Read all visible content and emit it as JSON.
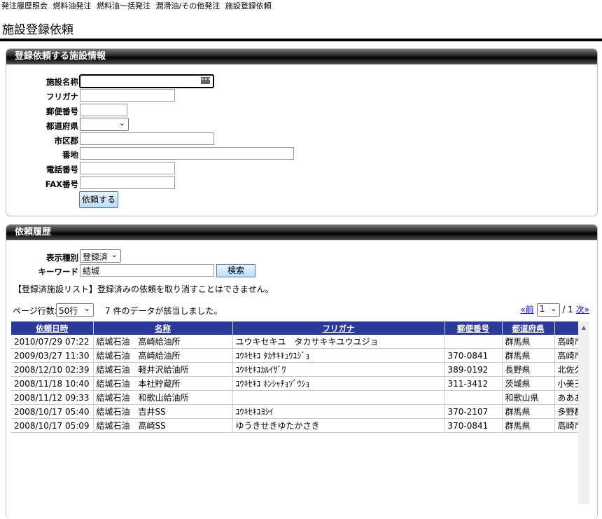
{
  "nav": {
    "items": [
      "発注履歴照会",
      "燃料油発注",
      "燃料油一括発注",
      "潤滑油/その他発注",
      "施設登録依頼"
    ]
  },
  "page_title": "施設登録依頼",
  "register_panel": {
    "title": "登録依頼する施設情報",
    "labels": {
      "name": "施設名称",
      "kana": "フリガナ",
      "zip": "郵便番号",
      "pref": "都道府県",
      "city": "市区郡",
      "address": "番地",
      "tel": "電話番号",
      "fax": "FAX番号"
    },
    "values": {
      "name": "",
      "kana": "",
      "zip": "",
      "pref": "",
      "city": "",
      "address": "",
      "tel": "",
      "fax": ""
    },
    "name_field_icon": "ellipsis-icon",
    "submit_label": "依頼する"
  },
  "history_panel": {
    "title": "依頼履歴",
    "type_label": "表示種別",
    "type_value": "登録済",
    "keyword_label": "キーワード",
    "keyword_value": "結城",
    "search_label": "検索",
    "notice": "【登録済施設リスト】登録済みの依頼を取り消すことはできません。",
    "page_rows_label": "ページ行数:",
    "page_rows_value": "50行",
    "count_text": "7 件のデータが該当しました。",
    "pager": {
      "prev": "«前",
      "page": "1",
      "total": "/ 1",
      "next": "次»"
    }
  },
  "table": {
    "columns": [
      "依頼日時",
      "名称",
      "フリガナ",
      "郵便番号",
      "都道府県",
      ""
    ],
    "rows": [
      [
        "2010/07/29 07:22",
        "結城石油　高崎給油所",
        "ユウキセキユ　タカサキキユウユジョ",
        "",
        "群馬県",
        "高崎市"
      ],
      [
        "2009/03/27 11:30",
        "結城石油　高崎給油所",
        "ﾕｳｷｾｷﾕ ﾀｶｻｷｷｭｳﾕｼﾞｮ",
        "370-0841",
        "群馬県",
        "高崎市"
      ],
      [
        "2008/12/10 02:39",
        "結城石油　軽井沢給油所",
        "ﾕｳｷｾｷﾕｶﾙｲｻﾞﾜ",
        "389-0192",
        "長野県",
        "北佐久"
      ],
      [
        "2008/11/18 10:40",
        "結城石油　本社貯蔵所",
        "ﾕｳｷｾｷﾕ ﾎﾝｼｬﾁｮｿﾞｳｼｮ",
        "311-3412",
        "茨城県",
        "小美玉"
      ],
      [
        "2008/11/12 09:33",
        "結城石油　和歌山給油所",
        "",
        "",
        "和歌山県",
        "あああ"
      ],
      [
        "2008/10/17 05:40",
        "結城石油　吉井SS",
        "ﾕｳｷｾｷﾕﾖｼｲ",
        "370-2107",
        "群馬県",
        "多野郡"
      ],
      [
        "2008/10/17 05:09",
        "結城石油　高崎SS",
        "ゆうきせきゆたかさき",
        "370-0841",
        "群馬県",
        "高崎市"
      ]
    ]
  }
}
